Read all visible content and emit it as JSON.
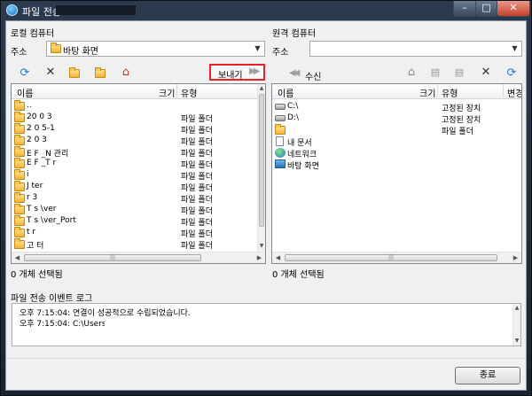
{
  "window": {
    "title": "파일 전송",
    "buttons": {
      "minimize": "–",
      "maximize": "□",
      "close": "✕"
    }
  },
  "local": {
    "section_label": "로컬 컴퓨터",
    "address_label": "주소",
    "address_value": "바탕 화면",
    "send_label": "보내기",
    "send_arrow": "▶▶",
    "columns": [
      "이름",
      "크기",
      "유형"
    ],
    "files": [
      {
        "name": "..",
        "type": ""
      },
      {
        "name": "20  0  3",
        "type": "파일 폴더"
      },
      {
        "name": "2  0  5-1",
        "type": "파일 폴더"
      },
      {
        "name": "2  0  3",
        "type": "파일 폴더"
      },
      {
        "name": "E  F  _N  관리",
        "type": "파일 폴더"
      },
      {
        "name": "E  F  _T  r",
        "type": "파일 폴더"
      },
      {
        "name": "i",
        "type": "파일 폴더"
      },
      {
        "name": "J  ter",
        "type": "파일 폴더"
      },
      {
        "name": "r  3",
        "type": "파일 폴더"
      },
      {
        "name": "T  s  \\ver",
        "type": "파일 폴더"
      },
      {
        "name": "T  s  \\ver_Port",
        "type": "파일 폴더"
      },
      {
        "name": "t  r",
        "type": "파일 폴더"
      },
      {
        "name": "고  터",
        "type": "파일 폴더"
      }
    ],
    "status": "0 개체 선택됨"
  },
  "remote": {
    "section_label": "원격 컴퓨터",
    "address_label": "주소",
    "address_value": "",
    "recv_label": "수신",
    "recv_arrow": "◀◀",
    "columns": [
      "이름",
      "크기",
      "유형",
      "변경"
    ],
    "files": [
      {
        "name": "C:\\",
        "type": "고정된 장치",
        "icon": "drive-icon"
      },
      {
        "name": "D:\\",
        "type": "고정된 장치",
        "icon": "drive-icon"
      },
      {
        "name": "",
        "type": "파일 폴더",
        "icon": "folder-icon"
      },
      {
        "name": "내 문서",
        "type": "",
        "icon": "documents-icon"
      },
      {
        "name": "네트워크",
        "type": "",
        "icon": "network-icon"
      },
      {
        "name": "바탕 화면",
        "type": "",
        "icon": "desktop-icon"
      }
    ],
    "status": "0 개체 선택됨"
  },
  "log": {
    "title": "파일 전송 이벤트 로그",
    "lines": [
      "오후 7:15:04: 연결이 성공적으로 수립되었습니다.",
      "오후 7:15:04: C:\\Users\\"
    ]
  },
  "close_button": "종료"
}
